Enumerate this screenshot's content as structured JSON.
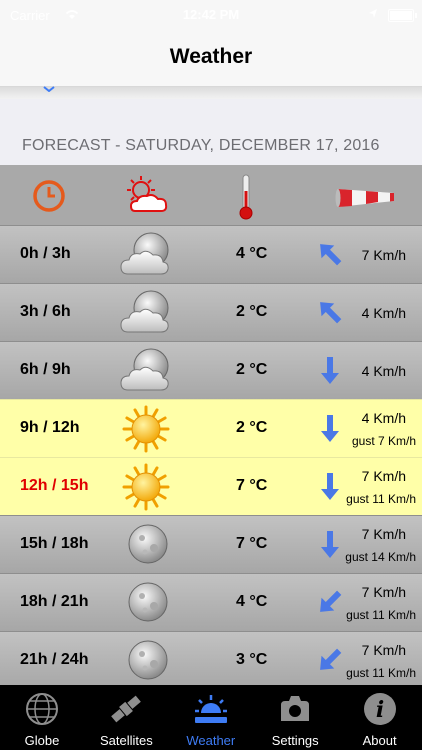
{
  "status_bar": {
    "carrier": "Carrier",
    "time": "12:42 PM"
  },
  "nav": {
    "title": "Weather"
  },
  "section": {
    "header": "FORECAST - SATURDAY, DECEMBER 17, 2016"
  },
  "columns": [
    {
      "icon": "clock-icon"
    },
    {
      "icon": "sun-cloud-icon"
    },
    {
      "icon": "thermometer-icon"
    },
    {
      "icon": "windsock-icon"
    }
  ],
  "rows": [
    {
      "time": "0h / 3h",
      "condition": "cloudy-night",
      "temp": "4 °C",
      "wind": "7 Km/h",
      "gust": "",
      "direction": "northwest",
      "highlight": false,
      "current": false
    },
    {
      "time": "3h / 6h",
      "condition": "cloudy-night",
      "temp": "2 °C",
      "wind": "4 Km/h",
      "gust": "",
      "direction": "northwest",
      "highlight": false,
      "current": false
    },
    {
      "time": "6h / 9h",
      "condition": "cloudy-night",
      "temp": "2 °C",
      "wind": "4 Km/h",
      "gust": "",
      "direction": "south",
      "highlight": false,
      "current": false
    },
    {
      "time": "9h / 12h",
      "condition": "sun",
      "temp": "2 °C",
      "wind": "4 Km/h",
      "gust": "gust 7 Km/h",
      "direction": "south",
      "highlight": true,
      "current": false
    },
    {
      "time": "12h / 15h",
      "condition": "sun",
      "temp": "7 °C",
      "wind": "7 Km/h",
      "gust": "gust 11 Km/h",
      "direction": "south",
      "highlight": true,
      "current": true
    },
    {
      "time": "15h / 18h",
      "condition": "moon",
      "temp": "7 °C",
      "wind": "7 Km/h",
      "gust": "gust 14 Km/h",
      "direction": "south",
      "highlight": false,
      "current": false
    },
    {
      "time": "18h / 21h",
      "condition": "moon",
      "temp": "4 °C",
      "wind": "7 Km/h",
      "gust": "gust 11 Km/h",
      "direction": "southwest",
      "highlight": false,
      "current": false
    },
    {
      "time": "21h / 24h",
      "condition": "moon",
      "temp": "3 °C",
      "wind": "7 Km/h",
      "gust": "gust 11 Km/h",
      "direction": "southwest",
      "highlight": false,
      "current": false
    }
  ],
  "tabs": [
    {
      "label": "Globe",
      "icon": "globe-icon",
      "active": false
    },
    {
      "label": "Satellites",
      "icon": "satellite-icon",
      "active": false
    },
    {
      "label": "Weather",
      "icon": "weather-icon",
      "active": true
    },
    {
      "label": "Settings",
      "icon": "settings-icon",
      "active": false
    },
    {
      "label": "About",
      "icon": "info-icon",
      "active": false
    }
  ],
  "colors": {
    "highlight": "#ffffa8",
    "current_time": "#e00000",
    "arrow": "#4a78e6",
    "tab_active": "#3e7cf5"
  }
}
